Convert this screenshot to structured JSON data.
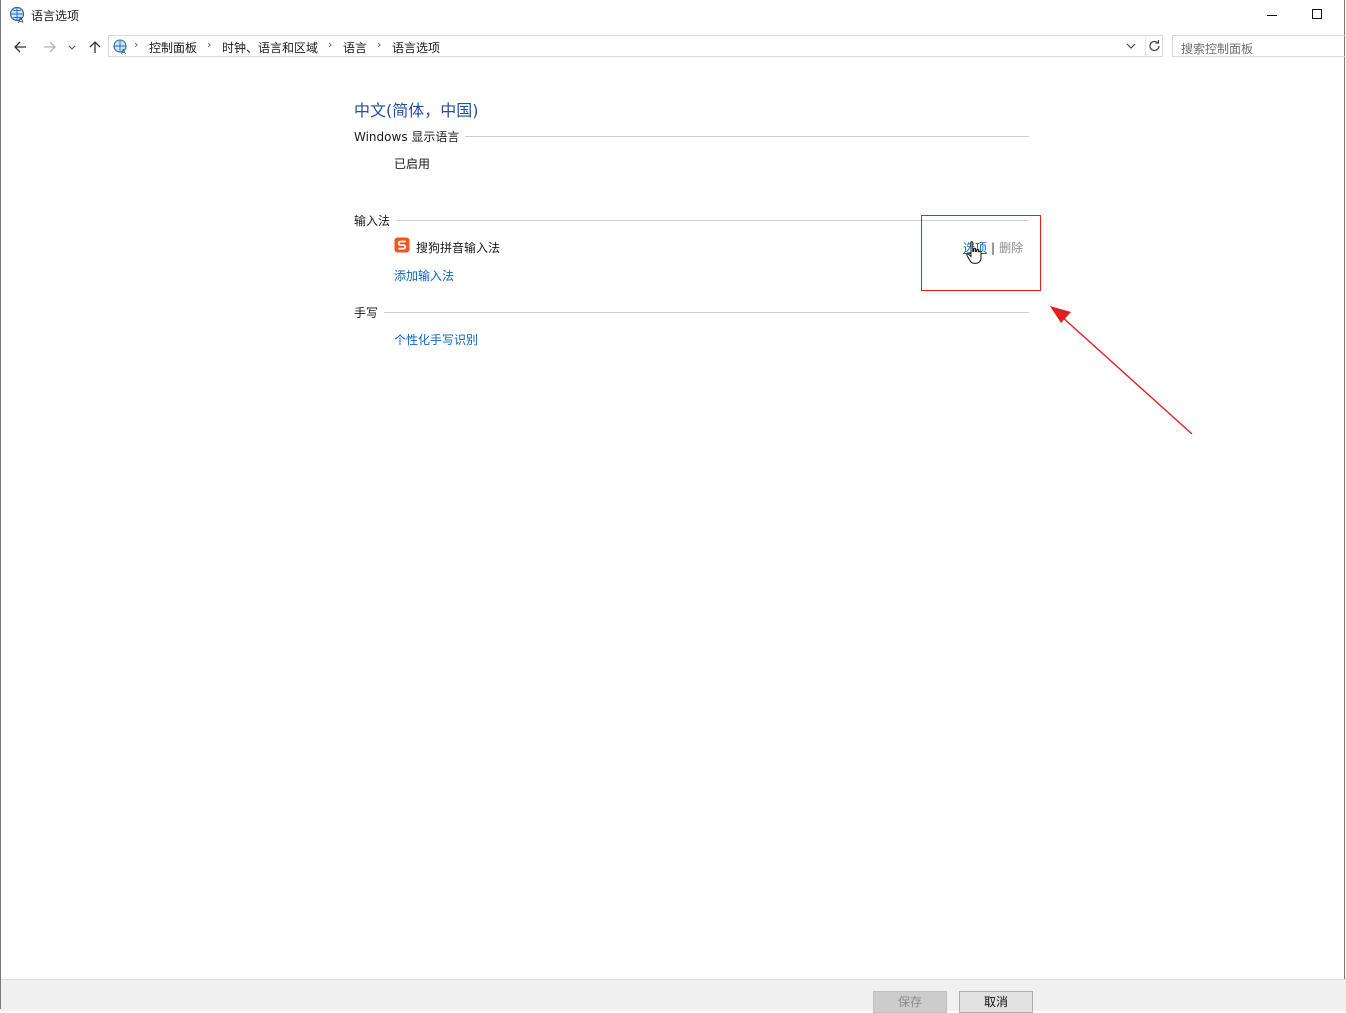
{
  "window": {
    "title": "语言选项",
    "icon": "language-globe-icon"
  },
  "nav": {
    "breadcrumbs": [
      "控制面板",
      "时钟、语言和区域",
      "语言",
      "语言选项"
    ],
    "search_placeholder": "搜索控制面板"
  },
  "language": {
    "name": "中文(简体，中国)",
    "display_section": "Windows 显示语言",
    "display_status": "已启用",
    "input_section": "输入法",
    "ime_name": "搜狗拼音输入法",
    "ime_options": "选项",
    "ime_separator": "|",
    "ime_delete": "删除",
    "add_ime": "添加输入法",
    "handwriting_section": "手写",
    "handwriting_link": "个性化手写识别"
  },
  "footer": {
    "save": "保存",
    "cancel": "取消"
  },
  "colors": {
    "accent_link": "#0a64c8",
    "title_blue": "#1e50a0",
    "annotation_red": "#e02020",
    "sogou_orange": "#f0561e"
  }
}
